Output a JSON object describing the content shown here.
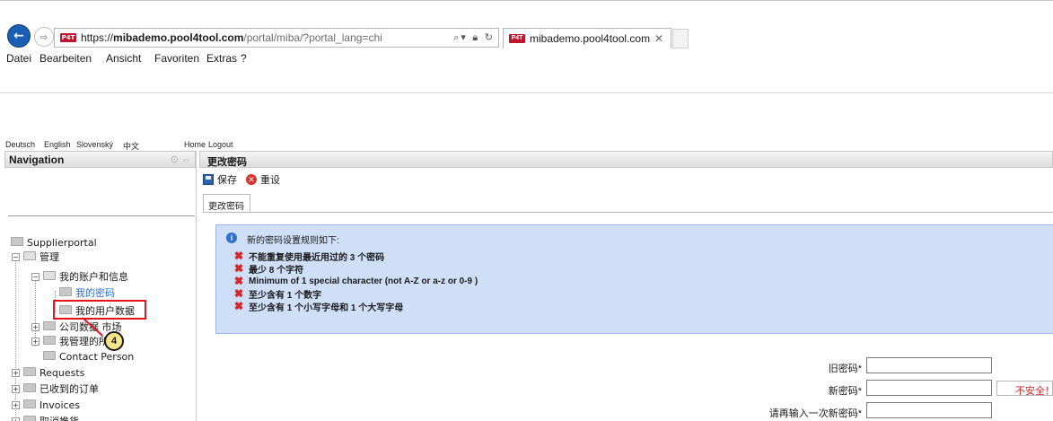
{
  "browser": {
    "url_scheme": "https://",
    "url_host": "mibademo.pool4tool.com",
    "url_path": "/portal/miba/?portal_lang=chi",
    "favicon_label": "P4T",
    "tab_title": "mibademo.pool4tool.com",
    "menu": [
      "Datei",
      "Bearbeiten",
      "Ansicht",
      "Favoriten",
      "Extras",
      "?"
    ]
  },
  "languages": [
    "Deutsch",
    "English",
    "Slovenský",
    "中文"
  ],
  "top_links": {
    "home": "Home",
    "logout": "Logout"
  },
  "navigation": {
    "title": "Navigation",
    "tree": {
      "root": "Supplierportal",
      "manage": "管理",
      "my_account": "我的账户和信息",
      "my_password": "我的密码",
      "my_user_data": "我的用户数据",
      "company_data": "公司数据 市场",
      "my_managed": "我管理的所",
      "contact_person": "Contact Person",
      "requests": "Requests",
      "orders_received": "已收到的订单",
      "invoices": "Invoices",
      "cut_off": "取消推货"
    },
    "callout_number": "4"
  },
  "main": {
    "title": "更改密码",
    "toolbar": {
      "save": "保存",
      "reset": "重设"
    },
    "tab": "更改密码",
    "info": {
      "title": "新的密码设置规则如下:",
      "rules": [
        "不能重复使用最近用过的 3 个密码",
        "最少 8 个字符",
        "Minimum of 1 special character (not A-Z or a-z or 0-9 )",
        "至少含有 1 个数字",
        "至少含有 1 个小写字母和 1 个大写字母"
      ]
    },
    "form": {
      "old_password_label": "旧密码*",
      "new_password_label": "新密码*",
      "confirm_password_label": "请再输入一次新密码*",
      "strength": "不安全！"
    }
  }
}
